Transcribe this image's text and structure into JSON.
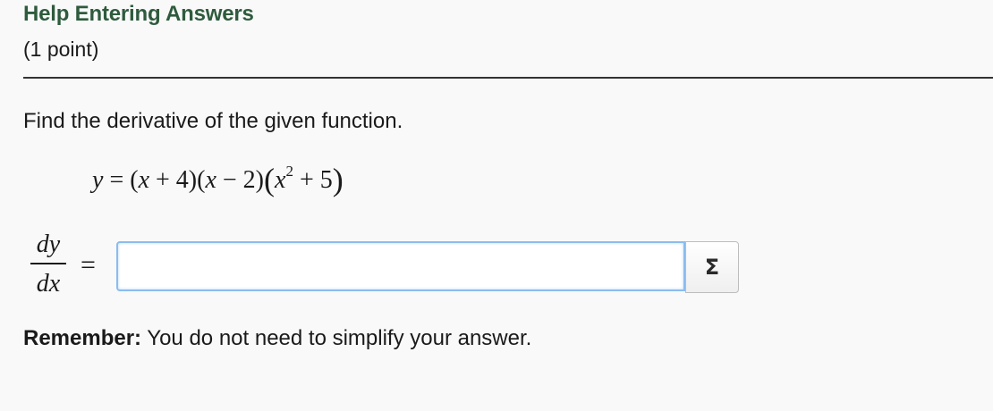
{
  "header": {
    "help_link": "Help Entering Answers",
    "points": "(1 point)"
  },
  "problem": {
    "prompt": "Find the derivative of the given function.",
    "equation": {
      "lhs": "y",
      "eq": "=",
      "factor1_open": "(",
      "factor1_var": "x",
      "factor1_rest": " + 4)",
      "factor2_open": "(",
      "factor2_var": "x",
      "factor2_rest": " − 2)",
      "factor3_open": "(",
      "factor3_var": "x",
      "factor3_exp": "2",
      "factor3_rest": " + 5",
      "factor3_close": ")"
    },
    "answer_label": {
      "numerator": "dy",
      "denominator": "dx",
      "equals": "="
    },
    "answer_input": {
      "value": "",
      "placeholder": ""
    },
    "equation_editor_icon": "Σ"
  },
  "remember": {
    "label": "Remember:",
    "text": " You do not need to simplify your answer."
  },
  "colors": {
    "link": "#2e5b3d",
    "input_border": "#8cbcee",
    "background": "#f9f9f9"
  },
  "icons": {
    "equation_editor": "sigma-icon"
  }
}
